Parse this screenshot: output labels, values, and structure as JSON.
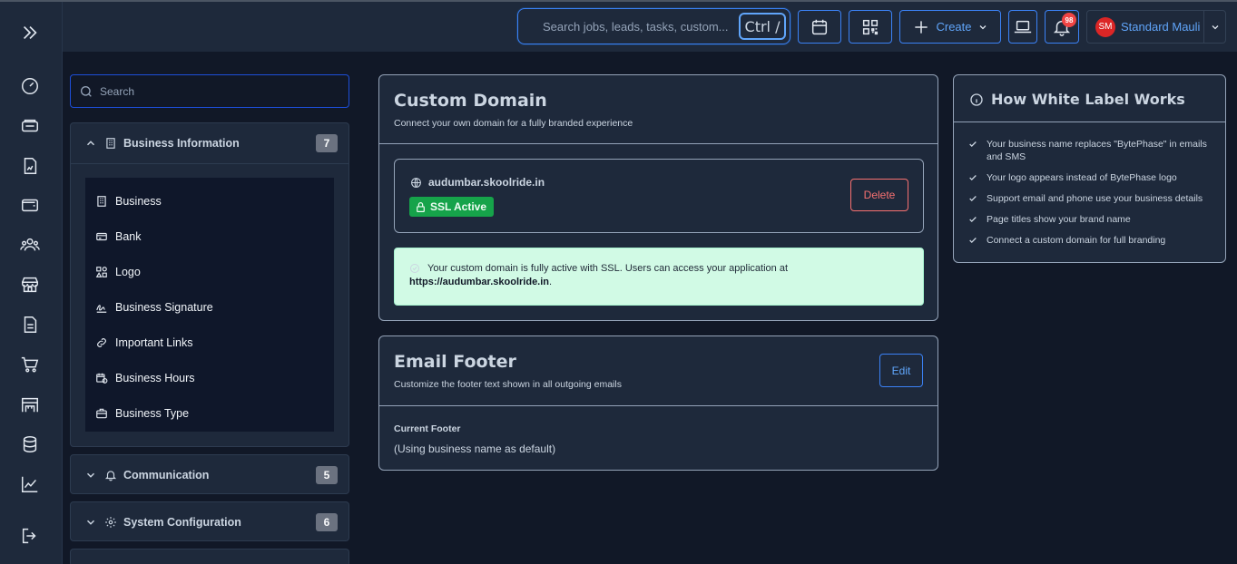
{
  "topbar": {
    "search_placeholder": "Search jobs, leads, tasks, custom...",
    "search_shortcut": "Ctrl /",
    "create_label": "Create",
    "notification_count": "98",
    "user_initials": "SM",
    "user_name": "Standard Mauli"
  },
  "rail": {
    "icons": [
      "expand-icon",
      "dashboard-icon",
      "jobs-icon",
      "reports-icon",
      "wallet-icon",
      "team-icon",
      "store-icon",
      "documents-icon",
      "cart-icon",
      "warehouse-icon",
      "database-icon",
      "analytics-icon",
      "logout-icon"
    ]
  },
  "settings_nav": {
    "search_placeholder": "Search",
    "groups": [
      {
        "label": "Business Information",
        "count": "7",
        "items": [
          "Business",
          "Bank",
          "Logo",
          "Business Signature",
          "Important Links",
          "Business Hours",
          "Business Type"
        ]
      },
      {
        "label": "Communication",
        "count": "5"
      },
      {
        "label": "System Configuration",
        "count": "6"
      }
    ]
  },
  "custom_domain": {
    "title": "Custom Domain",
    "subtitle": "Connect your own domain for a fully branded experience",
    "domain": "audumbar.skoolride.in",
    "ssl_status": "SSL Active",
    "delete_label": "Delete",
    "notice_text": "Your custom domain is fully active with SSL. Users can access your application at",
    "notice_link": "https://audumbar.skoolride.in",
    "notice_end": "."
  },
  "email_footer": {
    "title": "Email Footer",
    "subtitle": "Customize the footer text shown in all outgoing emails",
    "edit_label": "Edit",
    "current_label": "Current Footer",
    "current_value": "(Using business name as default)"
  },
  "white_label": {
    "title": "How White Label Works",
    "points": [
      "Your business name replaces \"BytePhase\" in emails and SMS",
      "Your logo appears instead of BytePhase logo",
      "Support email and phone use your business details",
      "Page titles show your brand name",
      "Connect a custom domain for full branding"
    ]
  },
  "colors": {
    "background": "#111827",
    "panel": "#1e293b",
    "accent": "#3b82f6",
    "success": "#16a34a",
    "danger": "#f87171",
    "badge": "#ef4444"
  }
}
